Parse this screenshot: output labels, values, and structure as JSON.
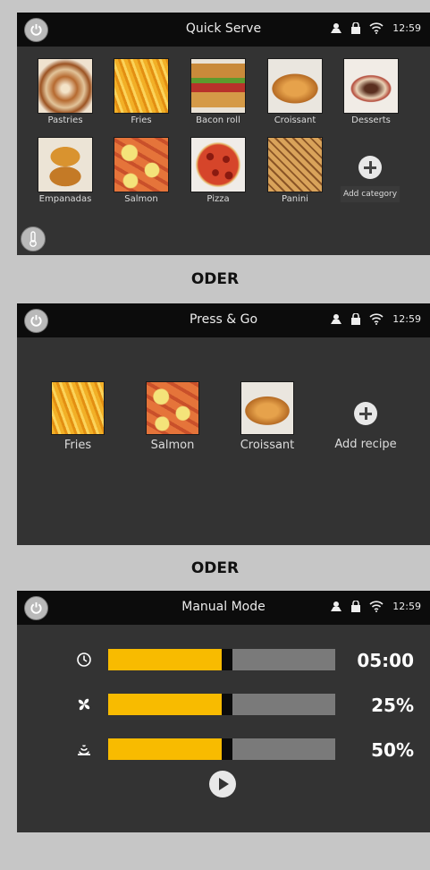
{
  "status": {
    "time": "12:59"
  },
  "quick_serve": {
    "title": "Quick Serve",
    "categories": [
      {
        "label": "Pastries"
      },
      {
        "label": "Fries"
      },
      {
        "label": "Bacon roll"
      },
      {
        "label": "Croissant"
      },
      {
        "label": "Desserts"
      },
      {
        "label": "Empanadas"
      },
      {
        "label": "Salmon"
      },
      {
        "label": "Pizza"
      },
      {
        "label": "Panini"
      }
    ],
    "add_category_label": "Add category"
  },
  "separator_1": "ODER",
  "press_go": {
    "title": "Press & Go",
    "recipes": [
      {
        "label": "Fries"
      },
      {
        "label": "Salmon"
      },
      {
        "label": "Croissant"
      }
    ],
    "add_recipe_label": "Add recipe"
  },
  "separator_2": "ODER",
  "manual_mode": {
    "title": "Manual Mode",
    "rows": [
      {
        "icon": "clock-icon",
        "value": "05:00",
        "fill": 0.5
      },
      {
        "icon": "fan-icon",
        "value": "25%",
        "fill": 0.5
      },
      {
        "icon": "steam-icon",
        "value": "50%",
        "fill": 0.5
      }
    ]
  },
  "colors": {
    "accent": "#f8bb00",
    "panel": "#333333",
    "topbar": "#0c0c0c"
  }
}
